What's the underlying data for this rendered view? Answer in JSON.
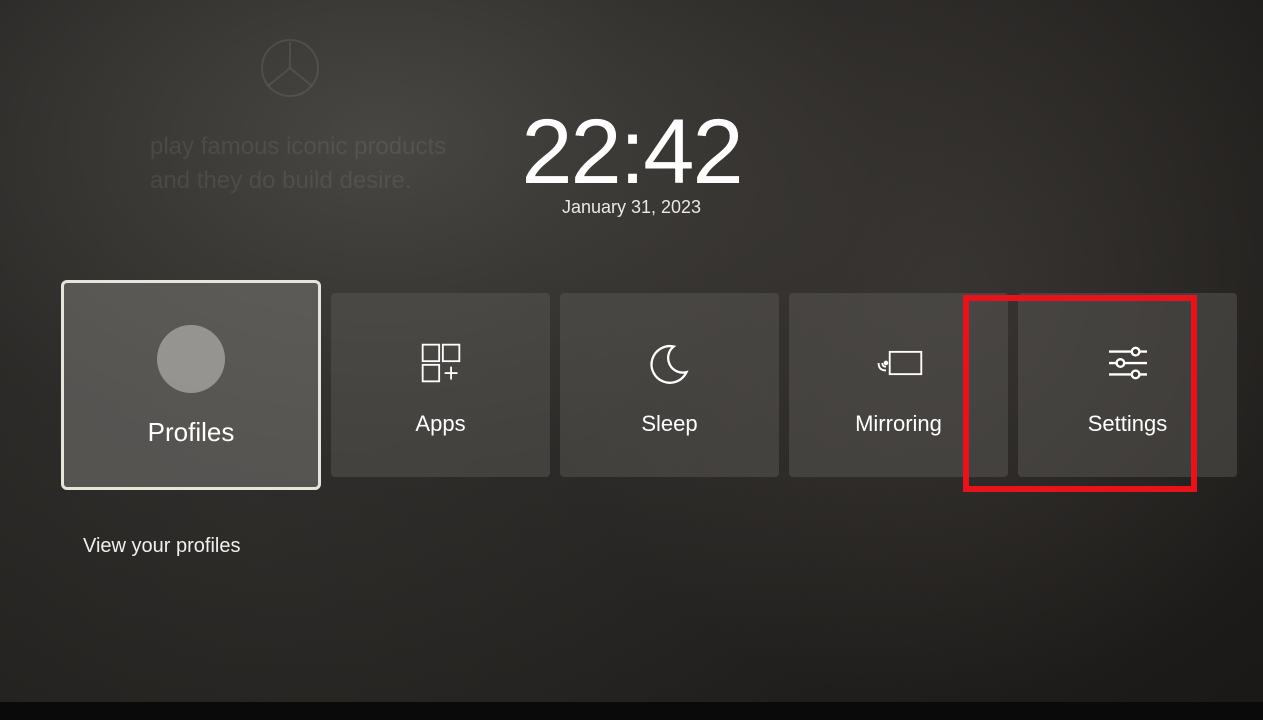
{
  "clock": {
    "time": "22:42",
    "date": "January 31, 2023"
  },
  "background": {
    "text_line1": "play famous iconic products",
    "text_line2": "and they do build desire."
  },
  "tiles": [
    {
      "id": "profiles",
      "label": "Profiles",
      "icon": "profile-icon",
      "selected": true
    },
    {
      "id": "apps",
      "label": "Apps",
      "icon": "apps-icon",
      "selected": false
    },
    {
      "id": "sleep",
      "label": "Sleep",
      "icon": "moon-icon",
      "selected": false
    },
    {
      "id": "mirroring",
      "label": "Mirroring",
      "icon": "mirroring-icon",
      "selected": false
    },
    {
      "id": "settings",
      "label": "Settings",
      "icon": "sliders-icon",
      "selected": false
    }
  ],
  "selected_description": "View your profiles",
  "highlight": {
    "target_tile_id": "settings"
  }
}
